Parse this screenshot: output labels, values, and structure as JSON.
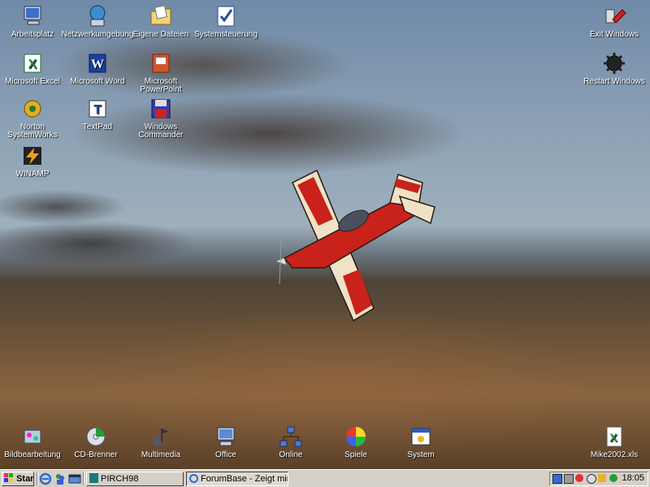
{
  "desktop_icons": {
    "arbeitsplatz": "Arbeitsplatz",
    "netzwerk": "Netzwerkumgebung",
    "eigene_dateien": "Eigene Dateien",
    "systemsteuerung": "Systemsteuerung",
    "excel": "Microsoft Excel",
    "word": "Microsoft Word",
    "powerpoint_1": "Microsoft",
    "powerpoint_2": "PowerPoint",
    "norton_1": "Norton",
    "norton_2": "SystemWorks",
    "textpad": "TextPad",
    "wincmd_1": "Windows",
    "wincmd_2": "Commander",
    "winamp": "WINAMP",
    "exit_windows": "Exit Windows",
    "restart_windows": "Restart Windows",
    "bildbearbeitung": "Bildbearbeitung",
    "cd_brenner": "CD-Brenner",
    "multimedia": "Multimedia",
    "office": "Office",
    "online": "Online",
    "spiele": "Spiele",
    "system": "System",
    "mike_xls": "Mike2002.xls"
  },
  "taskbar": {
    "start_label": "Start",
    "task_pirch": "PIRCH98",
    "task_forumbase": "ForumBase - Zeigt mir eu...",
    "clock": "18:05"
  },
  "colors": {
    "taskbar": "#d4d0c8",
    "plane_red": "#c8221a",
    "plane_cream": "#efe2c6"
  }
}
